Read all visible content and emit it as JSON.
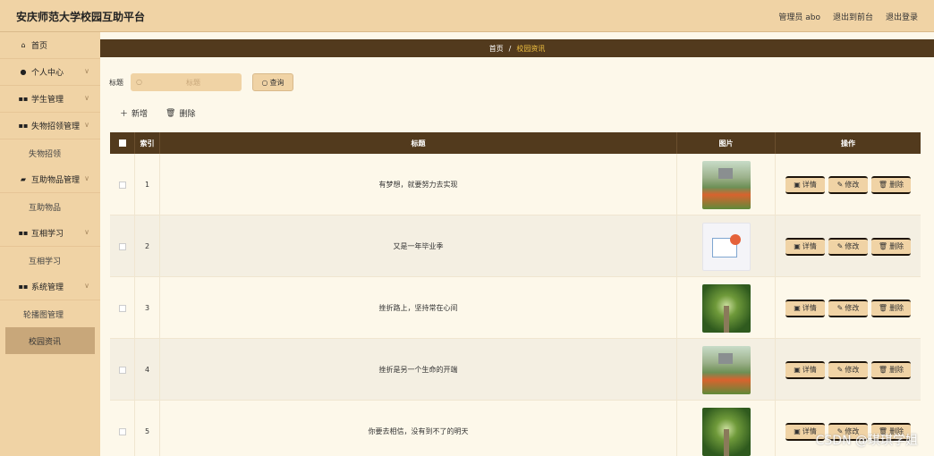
{
  "header": {
    "app_title": "安庆师范大学校园互助平台",
    "admin_label": "管理员 abo",
    "back_to_front": "退出到前台",
    "logout": "退出登录"
  },
  "sidebar": {
    "items": [
      {
        "icon": "home-icon",
        "glyph": "⌂",
        "label": "首页",
        "expandable": false
      },
      {
        "icon": "user-icon",
        "glyph": "●",
        "label": "个人中心",
        "expandable": true
      },
      {
        "icon": "grid-icon",
        "glyph": "▪▪",
        "label": "学生管理",
        "expandable": true
      },
      {
        "icon": "grid-icon",
        "glyph": "▪▪",
        "label": "失物招领管理",
        "expandable": true
      },
      {
        "icon": "",
        "glyph": "",
        "label": "失物招领",
        "sub": true
      },
      {
        "icon": "book-icon",
        "glyph": "▰",
        "label": "互助物品管理",
        "expandable": true
      },
      {
        "icon": "",
        "glyph": "",
        "label": "互助物品",
        "sub": true
      },
      {
        "icon": "grid-icon",
        "glyph": "▪▪",
        "label": "互相学习",
        "expandable": true
      },
      {
        "icon": "",
        "glyph": "",
        "label": "互相学习",
        "sub": true
      },
      {
        "icon": "grid-icon",
        "glyph": "▪▪",
        "label": "系统管理",
        "expandable": true
      },
      {
        "icon": "",
        "glyph": "",
        "label": "轮播图管理",
        "sub": true,
        "left": true
      },
      {
        "icon": "",
        "glyph": "",
        "label": "校园资讯",
        "sub": true,
        "active": true
      }
    ]
  },
  "breadcrumb": {
    "home": "首页",
    "separator": "/",
    "current": "校园资讯"
  },
  "search": {
    "label": "标题",
    "placeholder": "标题",
    "button": "查询"
  },
  "actions": {
    "add": "新增",
    "delete": "删除"
  },
  "table": {
    "columns": [
      "索引",
      "标题",
      "图片",
      "操作"
    ],
    "rows": [
      {
        "index": "1",
        "title": "有梦想，就要努力去实现",
        "image": "campus"
      },
      {
        "index": "2",
        "title": "又是一年毕业季",
        "image": "news"
      },
      {
        "index": "3",
        "title": "挫折路上，坚持常在心间",
        "image": "trees"
      },
      {
        "index": "4",
        "title": "挫折是另一个生命的开端",
        "image": "campus"
      },
      {
        "index": "5",
        "title": "你要去相信，没有到不了的明天",
        "image": "trees"
      }
    ],
    "op_labels": {
      "detail": "详情",
      "edit": "修改",
      "delete": "删除"
    }
  },
  "watermark": "CSDN @琪琪学姐",
  "colors": {
    "accent": "#f0d3a5",
    "dark": "#523a1d",
    "breadcrumb_current": "#f0c040"
  }
}
